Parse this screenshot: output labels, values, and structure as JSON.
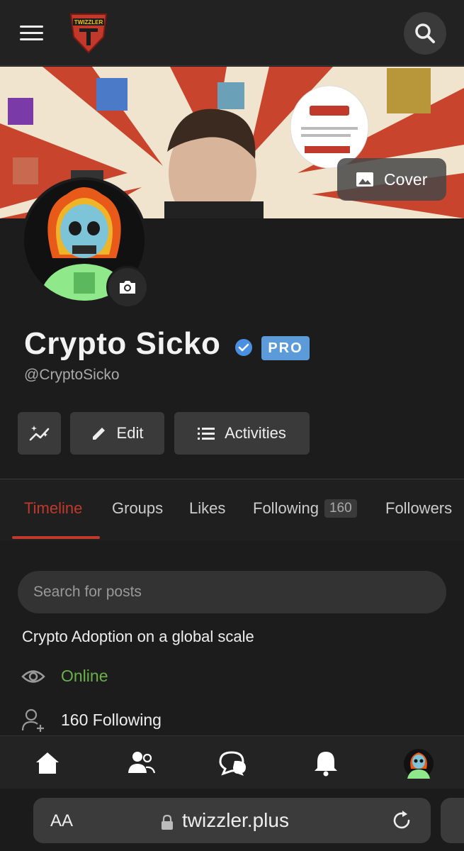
{
  "header": {
    "menu_icon": "hamburger-menu-icon",
    "logo_text": "TWIZZLER",
    "search_icon": "search-icon"
  },
  "cover": {
    "button_label": "Cover",
    "button_icon": "image-icon"
  },
  "profile": {
    "name": "Crypto Sicko",
    "handle": "@CryptoSicko",
    "pro_badge": "PRO",
    "verified_icon": "verified-check-icon",
    "camera_icon": "camera-icon"
  },
  "actions": {
    "stats_icon": "sparkle-chart-icon",
    "edit_label": "Edit",
    "activities_label": "Activities"
  },
  "tabs": [
    {
      "label": "Timeline",
      "active": true
    },
    {
      "label": "Groups"
    },
    {
      "label": "Likes"
    },
    {
      "label": "Following",
      "count": "160"
    },
    {
      "label": "Followers"
    }
  ],
  "search": {
    "placeholder": "Search for posts"
  },
  "about": {
    "bio": "Crypto Adoption on a global scale",
    "status": "Online",
    "following": "160 Following"
  },
  "bottom_nav": [
    "home-icon",
    "people-icon",
    "chat-icon",
    "bell-icon",
    "profile-avatar"
  ],
  "browser": {
    "text_size": "AA",
    "url": "twizzler.plus"
  },
  "colors": {
    "accent": "#c0392b",
    "online": "#6ab04c",
    "pro": "#5b9bd9",
    "verified": "#4a90e2"
  }
}
